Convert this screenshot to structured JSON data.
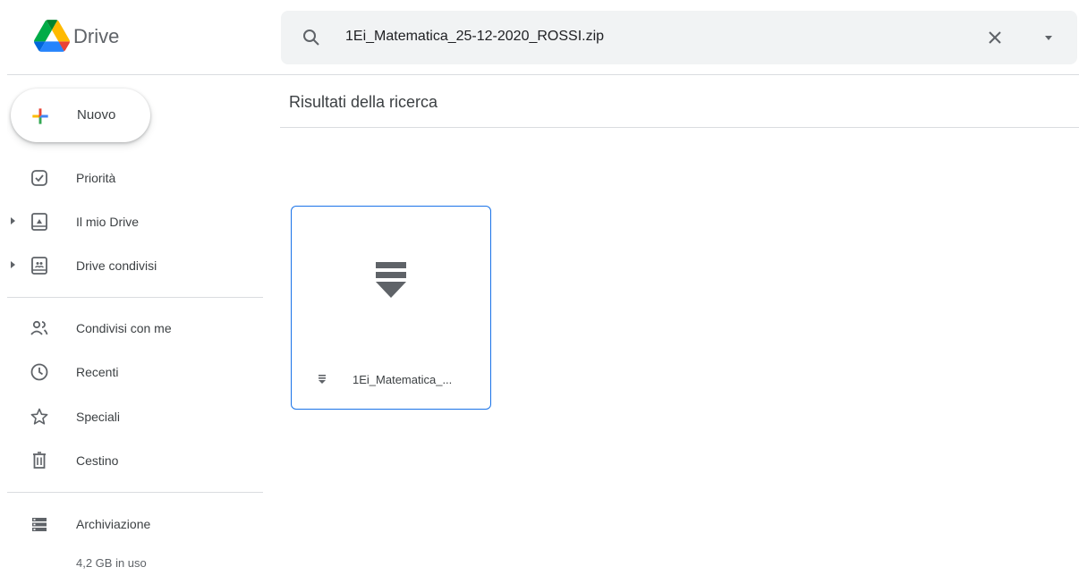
{
  "app": {
    "name": "Drive"
  },
  "search": {
    "query": "1Ei_Matematica_25-12-2020_ROSSI.zip",
    "search_icon": "search-icon",
    "clear_icon": "close-icon",
    "options_icon": "caret-down-icon"
  },
  "sidebar": {
    "new_button": {
      "label": "Nuovo",
      "icon": "plus-icon"
    },
    "items": [
      {
        "label": "Priorità",
        "icon": "priority-check-icon"
      },
      {
        "label": "Il mio Drive",
        "icon": "my-drive-icon"
      },
      {
        "label": "Drive condivisi",
        "icon": "shared-drives-icon"
      },
      {
        "label": "Condivisi con me",
        "icon": "people-icon"
      },
      {
        "label": "Recenti",
        "icon": "clock-icon"
      },
      {
        "label": "Speciali",
        "icon": "star-icon"
      },
      {
        "label": "Cestino",
        "icon": "trash-icon"
      },
      {
        "label": "Archiviazione",
        "icon": "storage-icon"
      }
    ],
    "storage_usage": "4,2 GB in uso"
  },
  "main": {
    "title": "Risultati della ricerca",
    "files": [
      {
        "name": "1Ei_Matematica_...",
        "type_icon": "zip-archive-icon"
      }
    ]
  },
  "colors": {
    "accent": "#1a73e8",
    "search_bg": "#f1f3f4",
    "icon_gray": "#5f6368",
    "divider": "#dadce0"
  }
}
